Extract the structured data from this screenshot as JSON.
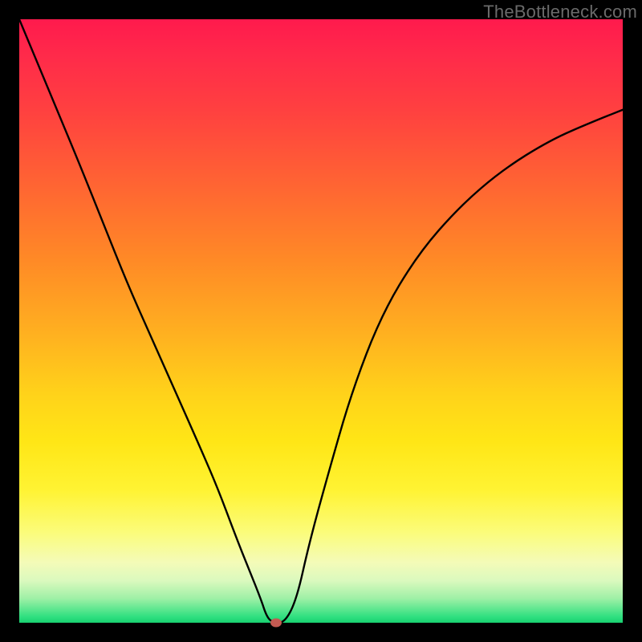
{
  "watermark": "TheBottleneck.com",
  "chart_data": {
    "type": "line",
    "title": "",
    "xlabel": "",
    "ylabel": "",
    "xlim": [
      0,
      100
    ],
    "ylim": [
      0,
      100
    ],
    "series": [
      {
        "name": "bottleneck-curve",
        "x": [
          0,
          5,
          10,
          14,
          18,
          22,
          26,
          30,
          33,
          36,
          38,
          40,
          41,
          42,
          44,
          46,
          48,
          51,
          55,
          60,
          66,
          73,
          80,
          88,
          95,
          100
        ],
        "y": [
          100,
          88,
          76,
          66,
          56,
          47,
          38,
          29,
          22,
          14,
          9,
          4,
          1,
          0,
          0,
          4,
          13,
          24,
          38,
          51,
          61,
          69,
          75,
          80,
          83,
          85
        ]
      }
    ],
    "marker": {
      "x": 42.5,
      "y": 0,
      "color": "#c35a52"
    },
    "gradient_stops": [
      {
        "pos": 0,
        "color": "#ff1a4d"
      },
      {
        "pos": 50,
        "color": "#ffb020"
      },
      {
        "pos": 80,
        "color": "#fff333"
      },
      {
        "pos": 100,
        "color": "#18d070"
      }
    ]
  }
}
